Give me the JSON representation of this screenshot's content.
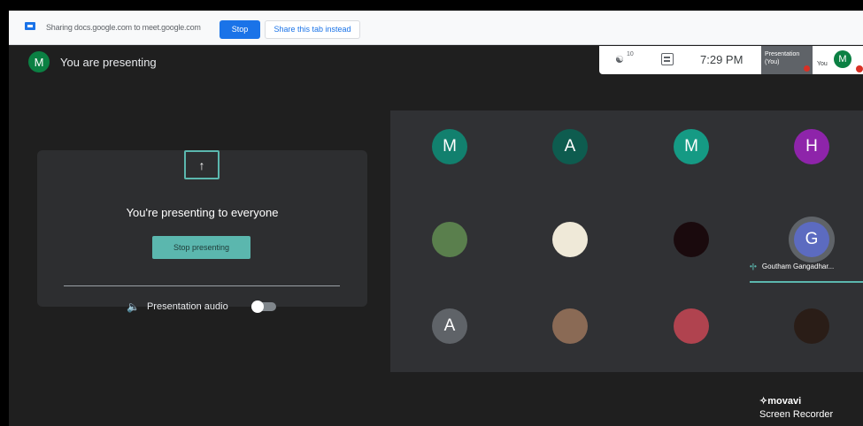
{
  "share_bar": {
    "message": "Sharing docs.google.com to meet.google.com",
    "stop_label": "Stop",
    "share_tab_label": "Share this tab instead"
  },
  "header": {
    "avatar_initial": "M",
    "presenting_text": "You are presenting"
  },
  "info_panel": {
    "people_count": "10",
    "time": "7:29 PM",
    "presentation_thumb_title": "Presentation",
    "presentation_thumb_sub": "(You)",
    "you_label": "You",
    "avatar_initial": "M"
  },
  "present_card": {
    "heading": "You're presenting to everyone",
    "stop_presenting_label": "Stop presenting",
    "audio_label": "Presentation audio",
    "audio_on": false
  },
  "participants": [
    {
      "initial": "M",
      "color": "#12806e",
      "kind": "letter"
    },
    {
      "initial": "A",
      "color": "#0e5c4f",
      "kind": "letter"
    },
    {
      "initial": "M",
      "color": "#159a84",
      "kind": "letter"
    },
    {
      "initial": "H",
      "color": "#8e24aa",
      "kind": "letter"
    },
    {
      "initial": "",
      "color": "#5a7f4d",
      "kind": "photo"
    },
    {
      "initial": "",
      "color": "#efe9d8",
      "kind": "photo"
    },
    {
      "initial": "",
      "color": "#1a0a0d",
      "kind": "photo"
    },
    {
      "initial": "G",
      "color": "#5c6bc0",
      "kind": "letter"
    },
    {
      "initial": "A",
      "color": "#5f6368",
      "kind": "letter"
    },
    {
      "initial": "",
      "color": "#8a6a55",
      "kind": "photo"
    },
    {
      "initial": "",
      "color": "#b0434f",
      "kind": "photo"
    },
    {
      "initial": "",
      "color": "#2a1d17",
      "kind": "photo"
    }
  ],
  "speaker_name": "Goutham Gangadhar...",
  "watermark": {
    "brand": "movavi",
    "product": "Screen Recorder"
  }
}
